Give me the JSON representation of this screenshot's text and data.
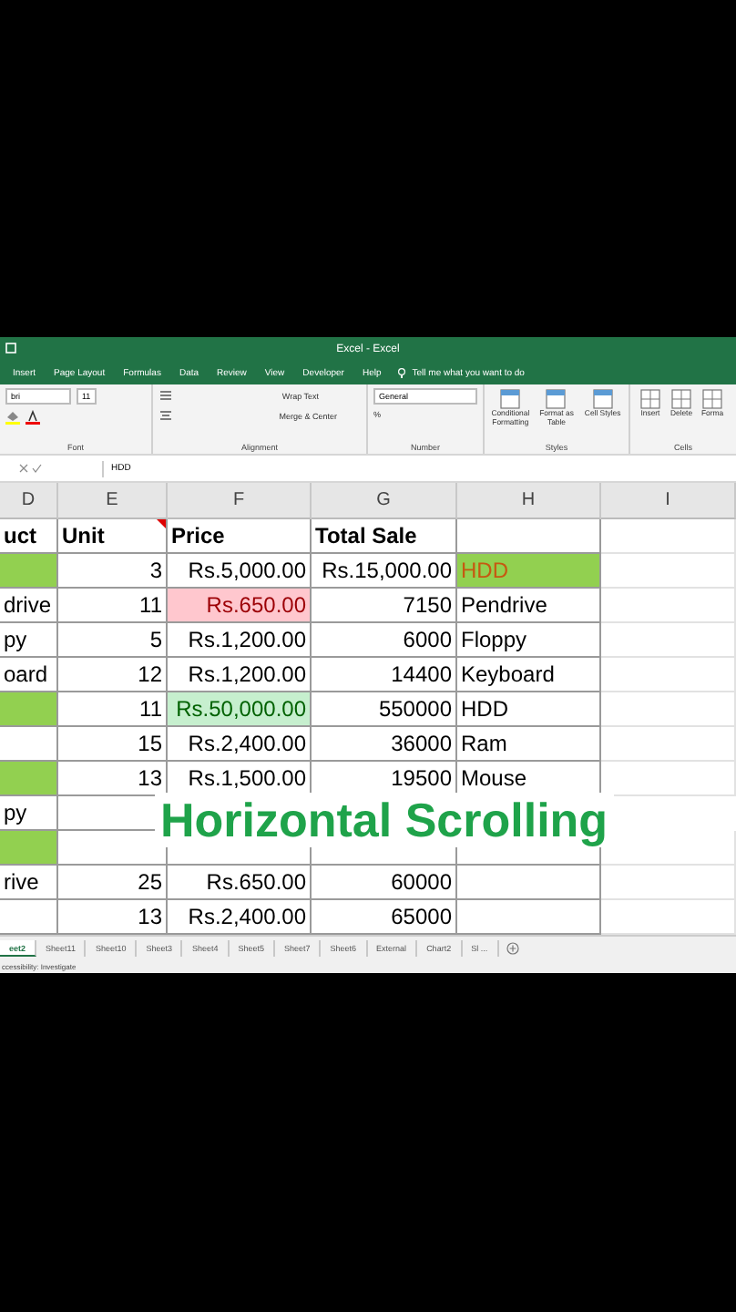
{
  "window": {
    "title": "Excel - Excel"
  },
  "ribbon_tabs": [
    {
      "label": "Insert"
    },
    {
      "label": "Page Layout"
    },
    {
      "label": "Formulas"
    },
    {
      "label": "Data"
    },
    {
      "label": "Review"
    },
    {
      "label": "View"
    },
    {
      "label": "Developer"
    },
    {
      "label": "Help"
    }
  ],
  "tell_me": "Tell me what you want to do",
  "ribbon": {
    "font": {
      "name": "bri",
      "size": "11",
      "label": "Font"
    },
    "alignment": {
      "wrap_text": "Wrap Text",
      "merge": "Merge & Center",
      "label": "Alignment"
    },
    "number": {
      "format": "General",
      "percent": "%",
      "label": "Number"
    },
    "styles": {
      "buttons": [
        "Conditional Formatting",
        "Format as Table",
        "Cell Styles"
      ],
      "label": "Styles"
    },
    "cells": {
      "buttons": [
        "Insert",
        "Delete",
        "Forma"
      ],
      "label": "Cells"
    }
  },
  "formula_bar": {
    "value": "HDD"
  },
  "columns": [
    {
      "label": "D",
      "kind": "text"
    },
    {
      "label": "E",
      "kind": "number"
    },
    {
      "label": "F",
      "kind": "number"
    },
    {
      "label": "G",
      "kind": "number"
    },
    {
      "label": "H",
      "kind": "text"
    },
    {
      "label": "I",
      "kind": "text"
    }
  ],
  "rows": [
    {
      "kind": "header",
      "cells": [
        {
          "text": "uct"
        },
        {
          "text": "Unit",
          "comment": true
        },
        {
          "text": "Price"
        },
        {
          "text": "Total Sale"
        },
        {},
        {}
      ]
    },
    {
      "kind": "data",
      "cells": [
        {
          "kind": "highlight"
        },
        {
          "text": "3"
        },
        {
          "text": "Rs.5,000.00"
        },
        {
          "text": "Rs.15,000.00"
        },
        {
          "text": "HDD",
          "kind": "alert"
        },
        {}
      ]
    },
    {
      "kind": "data",
      "cells": [
        {
          "text": "drive"
        },
        {
          "text": "11"
        },
        {
          "text": "Rs.650.00",
          "kind": "bad"
        },
        {
          "text": "7150"
        },
        {
          "text": "Pendrive"
        },
        {}
      ]
    },
    {
      "kind": "data",
      "cells": [
        {
          "text": "py"
        },
        {
          "text": "5"
        },
        {
          "text": "Rs.1,200.00"
        },
        {
          "text": "6000"
        },
        {
          "text": "Floppy"
        },
        {}
      ]
    },
    {
      "kind": "data",
      "cells": [
        {
          "text": "oard"
        },
        {
          "text": "12"
        },
        {
          "text": "Rs.1,200.00"
        },
        {
          "text": "14400"
        },
        {
          "text": "Keyboard"
        },
        {}
      ]
    },
    {
      "kind": "data",
      "cells": [
        {
          "kind": "highlight"
        },
        {
          "text": "11"
        },
        {
          "text": "Rs.50,000.00",
          "kind": "good"
        },
        {
          "text": "550000"
        },
        {
          "text": "HDD"
        },
        {}
      ]
    },
    {
      "kind": "data",
      "cells": [
        {},
        {
          "text": "15"
        },
        {
          "text": "Rs.2,400.00"
        },
        {
          "text": "36000"
        },
        {
          "text": "Ram"
        },
        {}
      ]
    },
    {
      "kind": "data",
      "cells": [
        {
          "kind": "highlight"
        },
        {
          "text": "13"
        },
        {
          "text": "Rs.1,500.00"
        },
        {
          "text": "19500"
        },
        {
          "text": "Mouse"
        },
        {}
      ]
    },
    {
      "kind": "data",
      "cells": [
        {
          "text": "py"
        },
        {}
      ]
    },
    {
      "kind": "data",
      "cells": [
        {
          "kind": "highlight"
        },
        {},
        {},
        {},
        {},
        {}
      ]
    },
    {
      "kind": "data",
      "cells": [
        {
          "text": "rive"
        },
        {
          "text": "25"
        },
        {
          "text": "Rs.650.00"
        },
        {
          "text": "60000"
        },
        {},
        {}
      ]
    },
    {
      "kind": "data",
      "cells": [
        {},
        {
          "text": "13"
        },
        {
          "text": "Rs.2,400.00"
        },
        {
          "text": "65000"
        },
        {},
        {}
      ]
    }
  ],
  "caption": "Horizontal Scrolling",
  "sheet_tabs": [
    {
      "label": "eet2",
      "selected": true
    },
    {
      "label": "Sheet11",
      "selected": false
    },
    {
      "label": "Sheet10",
      "selected": false
    },
    {
      "label": "Sheet3",
      "selected": false
    },
    {
      "label": "Sheet4",
      "selected": false
    },
    {
      "label": "Sheet5",
      "selected": false
    },
    {
      "label": "Sheet7",
      "selected": false
    },
    {
      "label": "Sheet6",
      "selected": false
    },
    {
      "label": "External",
      "selected": false
    },
    {
      "label": "Chart2",
      "selected": false
    },
    {
      "label": "Sl ...",
      "selected": false
    }
  ],
  "status_bar": "ccessibility: Investigate"
}
